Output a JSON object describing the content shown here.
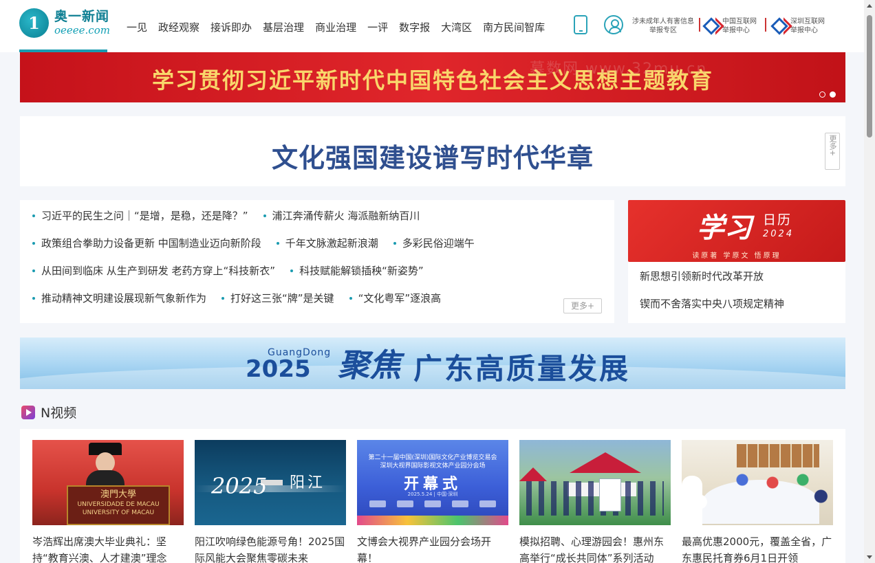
{
  "header": {
    "logo_cn": "奥一新闻",
    "logo_en": "oeeee.com",
    "nav": [
      "一见",
      "政经观察",
      "接诉即办",
      "基层治理",
      "商业治理",
      "一评",
      "数字报",
      "大湾区",
      "南方民间智库"
    ],
    "report_minor_line1": "涉未成年人有害信息",
    "report_minor_line2": "举报专区",
    "report_china_line1": "中国互联网",
    "report_china_line2": "举报中心",
    "report_sz_line1": "深圳互联网",
    "report_sz_line2": "举报中心"
  },
  "banner_top": {
    "text": "学习贯彻习近平新时代中国特色社会主义思想主题教育",
    "watermark": "慕数网  www.32mu.cn",
    "active_slide": 2,
    "slide_count": 2
  },
  "headline": {
    "title": "文化强国建设谱写时代华章",
    "more": "更多+"
  },
  "news": {
    "rows": [
      [
        "习近平的民生之问｜“是增，是稳，还是降？”",
        "浦江奔涌传薪火 海派融新纳百川"
      ],
      [
        "政策组合拳助力设备更新 中国制造业迈向新阶段",
        "千年文脉激起新浪潮",
        "多彩民俗迎端午"
      ],
      [
        "从田间到临床 从生产到研发 老药方穿上“科技新衣”",
        "科技赋能解锁插秧“新姿势”"
      ],
      [
        "推动精神文明建设展现新气象新作为",
        "打好这三张“牌”是关键",
        "“文化粤军”逐浪高"
      ]
    ],
    "more": "更多+"
  },
  "study": {
    "big": "学习",
    "cal": "日历",
    "year": "2024",
    "sub": "读原著  学原文  悟原理",
    "links": [
      "新思想引领新时代改革开放",
      "锲而不舍落实中央八项规定精神"
    ]
  },
  "gd_banner": {
    "en": "GuangDong",
    "year": "2025",
    "focus": "聚焦",
    "title": "广东高质量发展"
  },
  "video_section": {
    "title": "N视频",
    "items": [
      {
        "title": "岑浩辉出席澳大毕业典礼：坚持“教育兴澳、人才建澳”理念",
        "podium_cn": "澳門大學",
        "podium_pt": "UNIVERSIDADE DE MACAU",
        "podium_en": "UNIVERSITY OF MACAU"
      },
      {
        "title": "阳江吹响绿色能源号角！2025国际风能大会聚焦零碳未来",
        "big": "2025",
        "cn": "阳江"
      },
      {
        "title": "文博会大视界产业园分会场开幕！",
        "line1": "第二十一届中国(深圳)国际文化产业博览交易会",
        "line2": "深圳大视界国际影视文体产业园分会场",
        "open": "开幕式",
        "date": "2025.5.24 | 中国·深圳"
      },
      {
        "title": "模拟招聘、心理游园会！惠州东高举行“成长共同体”系列活动"
      },
      {
        "title": "最高优惠2000元，覆盖全省，广东惠民托育券6月1日开领"
      }
    ]
  }
}
